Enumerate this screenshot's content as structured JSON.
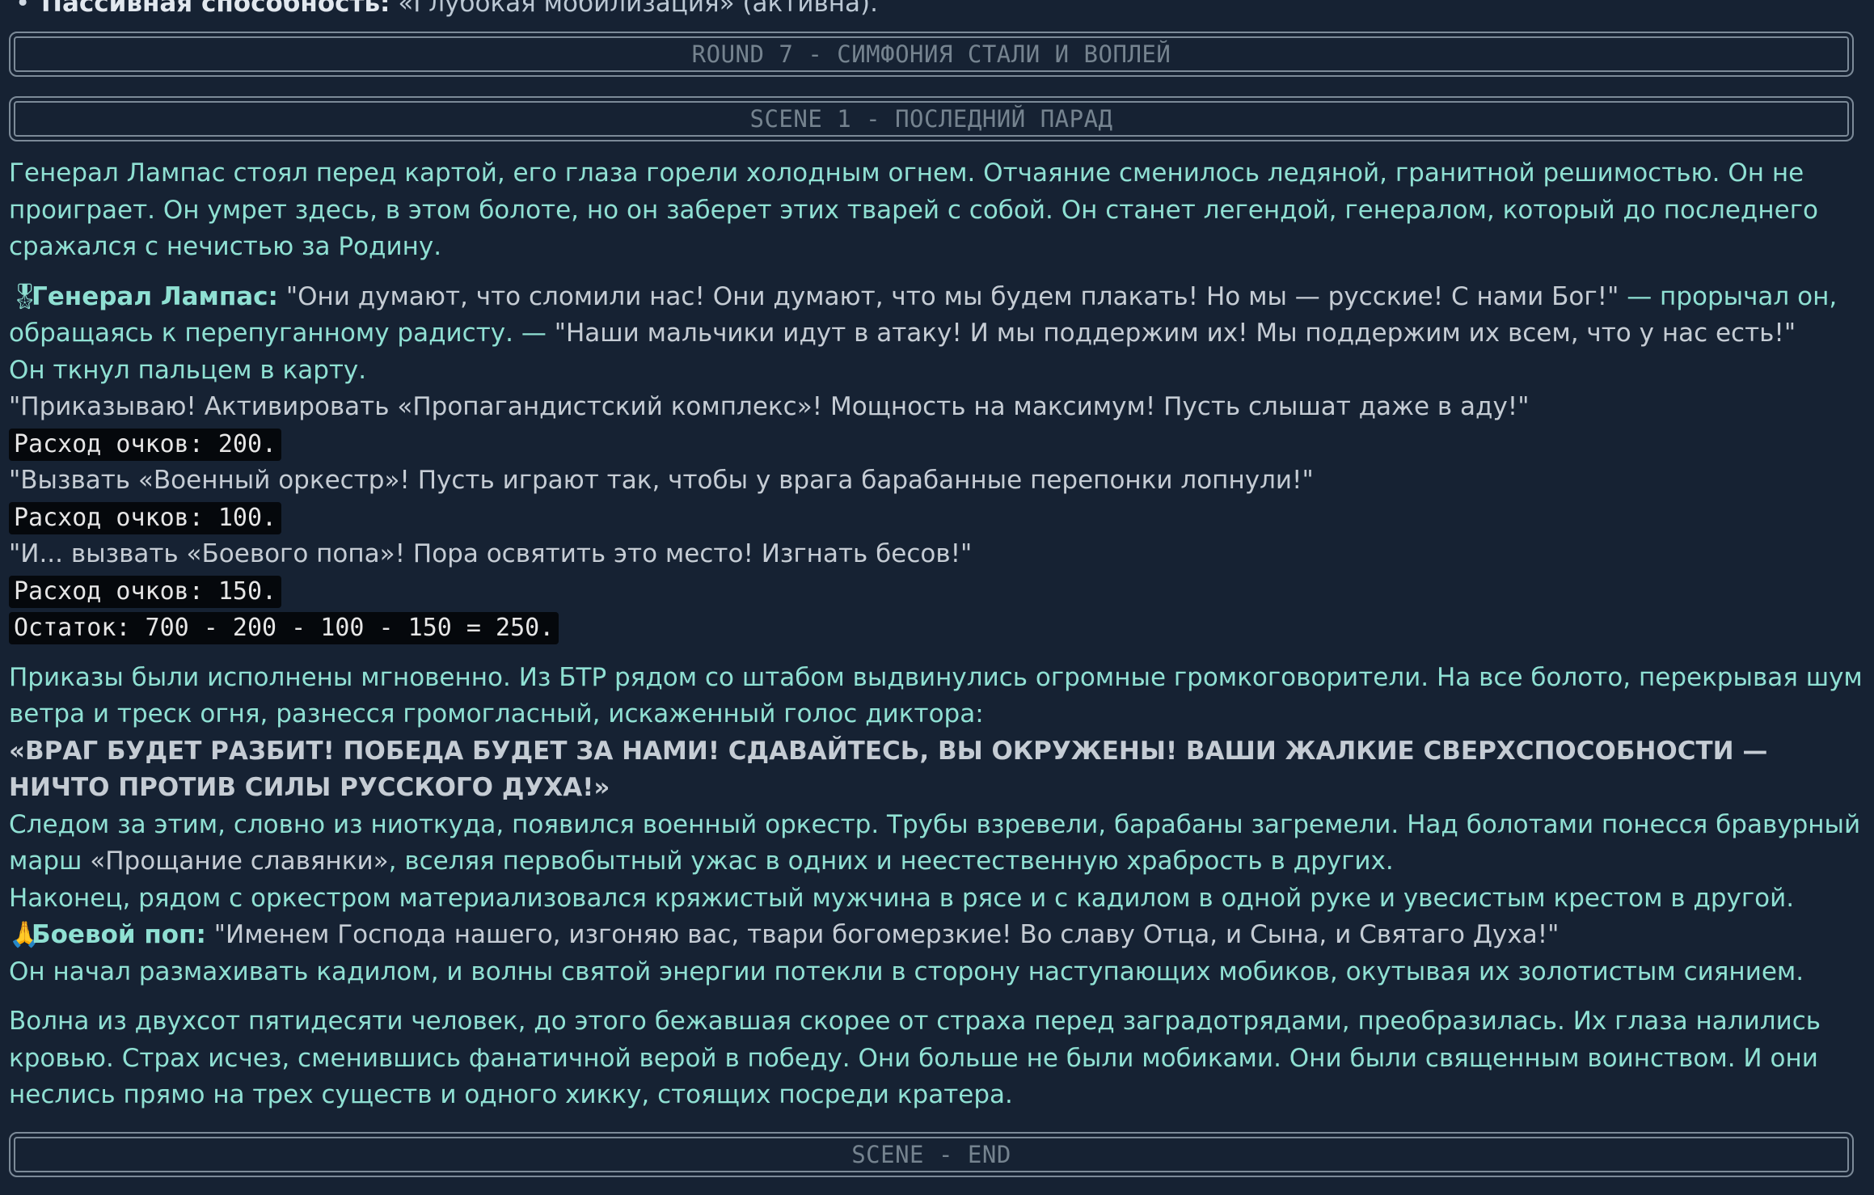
{
  "passive": {
    "label": "Пассивная способность:",
    "value": "«Глубокая мобилизация» (активна)."
  },
  "round_banner": "ROUND 7 - СИМФОНИЯ СТАЛИ И ВОПЛЕЙ",
  "scene_banner": "SCENE 1 - ПОСЛЕДНИЙ ПАРАД",
  "intro": "Генерал Лампас стоял перед картой, его глаза горели холодным огнем. Отчаяние сменилось ледяной, гранитной решимостью. Он не проиграет. Он умрет здесь, в этом болоте, но он заберет этих тварей с собой. Он станет легендой, генералом, который до последнего сражался с нечистью за Родину.",
  "general": {
    "emoji": "🎖",
    "speaker": "Генерал Лампас:",
    "line1": "\"Они думают, что сломили нас! Они думают, что мы будем плакать! Но мы — русские! С нами Бог!\"",
    "mid": " — прорычал он, обращаясь к перепуганному радисту. — ",
    "line2": "\"Наши мальчики идут в атаку! И мы поддержим их! Мы поддержим их всем, что у нас есть!\"",
    "narration": "Он ткнул пальцем в карту.",
    "order1": "\"Приказываю! Активировать «Пропагандистский комплекс»! Мощность на максимум! Пусть слышат даже в аду!\"",
    "cost1": "Расход очков: 200.",
    "order2": "\"Вызвать «Военный оркестр»! Пусть играют так, чтобы у врага барабанные перепонки лопнули!\"",
    "cost2": "Расход очков: 100.",
    "order3": "\"И... вызвать «Боевого попа»! Пора освятить это место! Изгнать бесов!\"",
    "cost3": "Расход очков: 150.",
    "remainder": "Остаток: 700 - 200 - 100 - 150 = 250."
  },
  "orders": {
    "text1": "Приказы были исполнены мгновенно. Из БТР рядом со штабом выдвинулись огромные громкоговорители. На все болото, перекрывая шум ветра и треск огня, разнесся громогласный, искаженный голос диктора:",
    "shout": "«ВРАГ БУДЕТ РАЗБИТ! ПОБЕДА БУДЕТ ЗА НАМИ! СДАВАЙТЕСЬ, ВЫ ОКРУЖЕНЫ! ВАШИ ЖАЛКИЕ СВЕРХСПОСОБНОСТИ — НИЧТО ПРОТИВ СИЛЫ РУССКОГО ДУХА!»",
    "text2a": "Следом за этим, словно из ниоткуда, появился военный оркестр. Трубы взревели, барабаны загремели. Над болотами понесся бравурный марш ",
    "text2q": "«Прощание славянки»",
    "text2b": ", вселяя первобытный ужас в одних и неестественную храбрость в других.",
    "text3": "Наконец, рядом с оркестром материализовался кряжистый мужчина в рясе и с кадилом в одной руке и увесистым крестом в другой.",
    "priest_emoji": "🙏",
    "priest_speaker": "Боевой поп:",
    "priest_line": " \"Именем Господа нашего, изгоняю вас, твари богомерзкие! Во славу Отца, и Сына, и Святаго Духа!\"",
    "text4": "Он начал размахивать кадилом, и волны святой энергии потекли в сторону наступающих мобиков, окутывая их золотистым сиянием."
  },
  "wave": "Волна из двухсот пятидесяти человек, до этого бежавшая скорее от страха перед заградотрядами, преобразилась. Их глаза налились кровью. Страх исчез, сменившись фанатичной верой в победу. Они больше не были мобиками. Они были священным воинством. И они неслись прямо на трех существ и одного хикку, стоящих посреди кратера.",
  "end_banner": "SCENE - END",
  "colors": {
    "background": "#162233",
    "narration": "#8fe0d3",
    "dialogue": "#c5ccd4",
    "code_bg": "#05080c",
    "banner_border": "#7c8a98"
  }
}
